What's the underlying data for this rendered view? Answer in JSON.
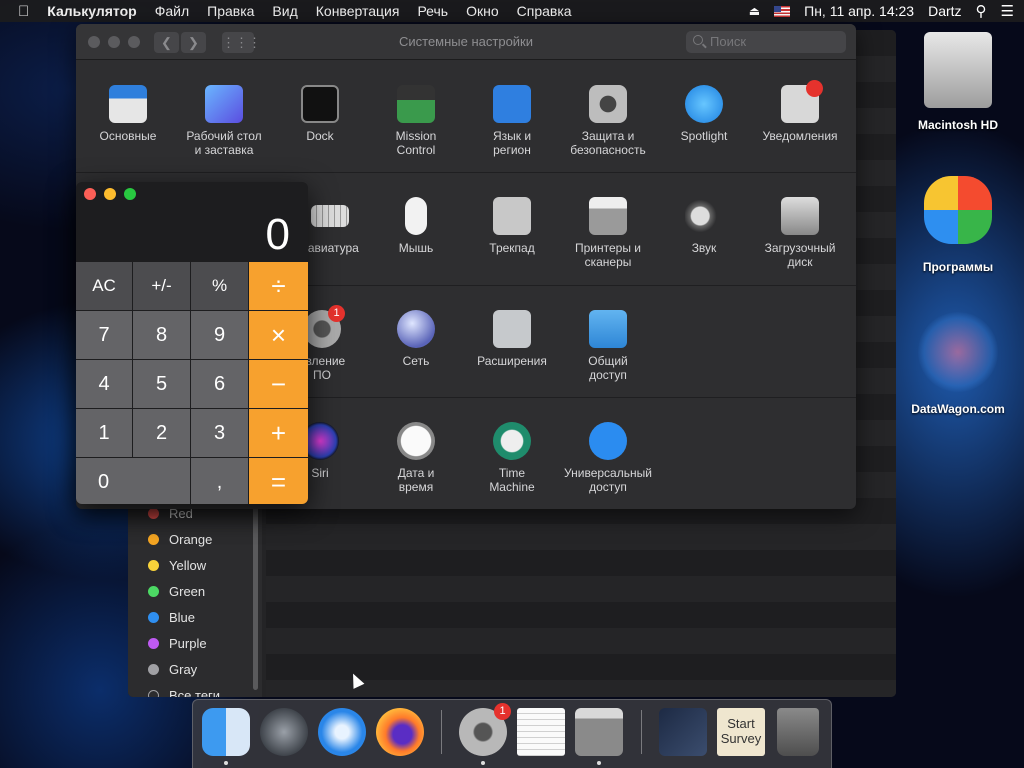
{
  "menubar": {
    "app": "Калькулятор",
    "items": [
      "Файл",
      "Правка",
      "Вид",
      "Конвертация",
      "Речь",
      "Окно",
      "Справка"
    ],
    "datetime": "Пн, 11 апр. 14:23",
    "user": "Dartz"
  },
  "finder": {
    "tags": [
      {
        "label": "Red",
        "color": "#f0524f"
      },
      {
        "label": "Orange",
        "color": "#f5a623"
      },
      {
        "label": "Yellow",
        "color": "#f8d33a"
      },
      {
        "label": "Green",
        "color": "#4cd964"
      },
      {
        "label": "Blue",
        "color": "#2f8ff0"
      },
      {
        "label": "Purple",
        "color": "#bf5af2"
      },
      {
        "label": "Gray",
        "color": "#a0a0a4"
      },
      {
        "label": "Все теги..."
      }
    ]
  },
  "sysprefs": {
    "title": "Системные настройки",
    "search_placeholder": "Поиск",
    "rows": [
      [
        {
          "icon": "general-icon",
          "label": "Основные"
        },
        {
          "icon": "desktop-icon",
          "label": "Рабочий стол\nи заставка"
        },
        {
          "icon": "dock-icon",
          "label": "Dock"
        },
        {
          "icon": "mission-control-icon",
          "label": "Mission\nControl"
        },
        {
          "icon": "language-region-icon",
          "label": "Язык и\nрегион"
        },
        {
          "icon": "security-icon",
          "label": "Защита и\nбезопасность"
        },
        {
          "icon": "spotlight-icon",
          "label": "Spotlight"
        },
        {
          "icon": "notifications-icon",
          "label": "Уведомления"
        }
      ],
      [
        {
          "icon": "keyboard-icon",
          "label": "иавиатура"
        },
        {
          "icon": "mouse-icon",
          "label": "Мышь"
        },
        {
          "icon": "trackpad-icon",
          "label": "Трекпад"
        },
        {
          "icon": "printers-icon",
          "label": "Принтеры и\nсканеры"
        },
        {
          "icon": "sound-icon",
          "label": "Звук"
        },
        {
          "icon": "startup-disk-icon",
          "label": "Загрузочный\nдиск"
        }
      ],
      [
        {
          "icon": "software-update-icon",
          "label": "овление\nПО",
          "badge": "1"
        },
        {
          "icon": "network-icon",
          "label": "Сеть"
        },
        {
          "icon": "extensions-icon",
          "label": "Расширения"
        },
        {
          "icon": "sharing-icon",
          "label": "Общий\nдоступ"
        }
      ],
      [
        {
          "icon": "siri-icon",
          "label": "Siri"
        },
        {
          "icon": "date-time-icon",
          "label": "Дата и\nвремя"
        },
        {
          "icon": "time-machine-icon",
          "label": "Time\nMachine"
        },
        {
          "icon": "accessibility-icon",
          "label": "Универсальный\nдоступ"
        }
      ]
    ]
  },
  "calculator": {
    "display": "0",
    "keys": [
      {
        "label": "AC",
        "type": "top"
      },
      {
        "label": "+/-",
        "type": "top"
      },
      {
        "label": "%",
        "type": "top"
      },
      {
        "label": "÷",
        "type": "op"
      },
      {
        "label": "7",
        "type": "num"
      },
      {
        "label": "8",
        "type": "num"
      },
      {
        "label": "9",
        "type": "num"
      },
      {
        "label": "×",
        "type": "op"
      },
      {
        "label": "4",
        "type": "num"
      },
      {
        "label": "5",
        "type": "num"
      },
      {
        "label": "6",
        "type": "num"
      },
      {
        "label": "−",
        "type": "op"
      },
      {
        "label": "1",
        "type": "num"
      },
      {
        "label": "2",
        "type": "num"
      },
      {
        "label": "3",
        "type": "num"
      },
      {
        "label": "+",
        "type": "op"
      },
      {
        "label": "0",
        "type": "num"
      },
      {
        "label": ",",
        "type": "num"
      },
      {
        "label": "=",
        "type": "op"
      }
    ]
  },
  "desktop": {
    "icons": [
      {
        "label": "Macintosh HD",
        "icon": "hard-drive-icon"
      },
      {
        "label": "Программы",
        "icon": "programs-icon"
      },
      {
        "label": "DataWagon.com",
        "icon": "datawagon-icon"
      }
    ]
  },
  "dock": {
    "items": [
      {
        "name": "finder",
        "icon": "finder-icon",
        "running": true
      },
      {
        "name": "launchpad",
        "icon": "launchpad-icon"
      },
      {
        "name": "safari",
        "icon": "safari-icon"
      },
      {
        "name": "firefox",
        "icon": "firefox-icon"
      },
      {
        "name": "system-preferences",
        "icon": "system-preferences-icon",
        "running": true,
        "badge": "1"
      },
      {
        "name": "textedit",
        "icon": "textedit-icon"
      },
      {
        "name": "calculator",
        "icon": "calculator-icon",
        "running": true
      },
      {
        "name": "stocks",
        "icon": "stocks-icon"
      },
      {
        "name": "start-survey",
        "icon": "start-survey-icon",
        "text": "Start\nSurvey"
      },
      {
        "name": "trash",
        "icon": "trash-icon"
      }
    ]
  }
}
